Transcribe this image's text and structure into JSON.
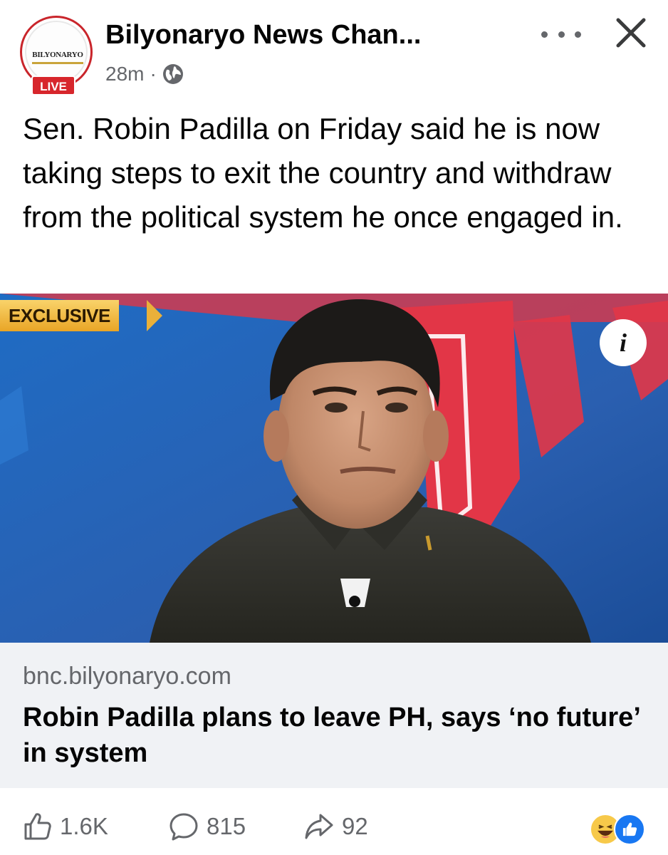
{
  "post": {
    "page_name": "Bilyonaryo News Chan...",
    "time": "28m",
    "separator": "·",
    "privacy_icon": "globe-icon",
    "avatar_logo_text": "BILYONARYO",
    "live_badge": "LIVE",
    "caption": "Sen. Robin Padilla on Friday said he is now taking steps to exit the country and withdraw from the political system he once engaged in."
  },
  "image": {
    "badge": "EXCLUSIVE",
    "info_label": "i"
  },
  "link": {
    "domain": "bnc.bilyonaryo.com",
    "title": "Robin Padilla plans to leave PH, says ‘no future’ in system"
  },
  "stats": {
    "likes": "1.6K",
    "comments": "815",
    "shares": "92"
  },
  "colors": {
    "brand_red": "#d7262c",
    "facebook_blue": "#1877f2",
    "link_bg": "#f0f2f5",
    "meta_gray": "#65676b"
  }
}
